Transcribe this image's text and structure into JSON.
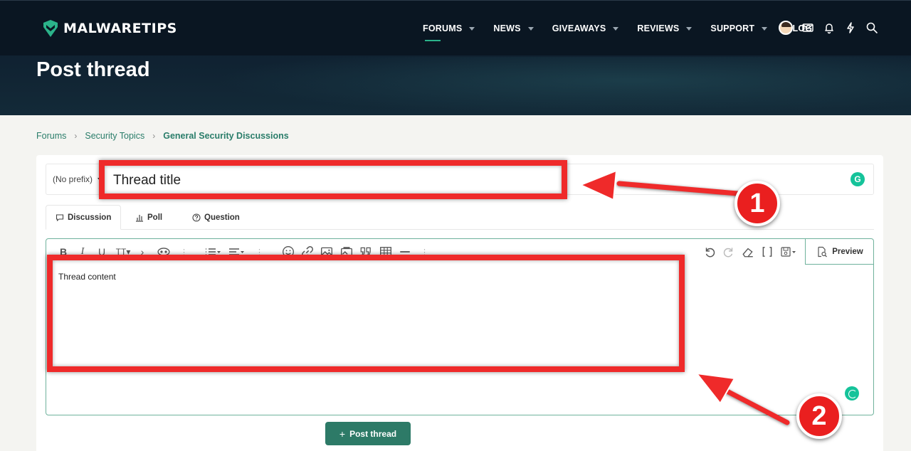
{
  "site": {
    "logo_text": "MALWARETIPS"
  },
  "nav": {
    "items": [
      {
        "label": "FORUMS",
        "has_caret": true,
        "active": true
      },
      {
        "label": "NEWS",
        "has_caret": true
      },
      {
        "label": "GIVEAWAYS",
        "has_caret": true
      },
      {
        "label": "REVIEWS",
        "has_caret": true
      },
      {
        "label": "SUPPORT",
        "has_caret": true
      },
      {
        "label": "BLOG",
        "has_caret": false
      }
    ],
    "icons": [
      "avatar",
      "mail-icon",
      "bell-icon",
      "lightning-icon",
      "search-icon"
    ]
  },
  "page": {
    "title": "Post thread"
  },
  "breadcrumb": [
    {
      "label": "Forums"
    },
    {
      "label": "Security Topics"
    },
    {
      "label": "General Security Discussions"
    }
  ],
  "form": {
    "prefix_label": "(No prefix)",
    "title_placeholder": "Thread title",
    "grammarly_label": "G",
    "tabs": [
      {
        "label": "Discussion",
        "icon": "chat-icon",
        "active": true
      },
      {
        "label": "Poll",
        "icon": "bar-chart-icon"
      },
      {
        "label": "Question",
        "icon": "question-circle-icon"
      }
    ],
    "editor": {
      "content_placeholder": "Thread content",
      "preview_label": "Preview"
    },
    "submit_label": "Post thread",
    "submit_icon": "+"
  },
  "annotations": [
    {
      "number": "1"
    },
    {
      "number": "2"
    }
  ],
  "colors": {
    "accent_green": "#2d7a67",
    "link_green": "#2a7d6a",
    "annotation_red": "#ef2a2a",
    "header_dark": "#0a1622"
  }
}
